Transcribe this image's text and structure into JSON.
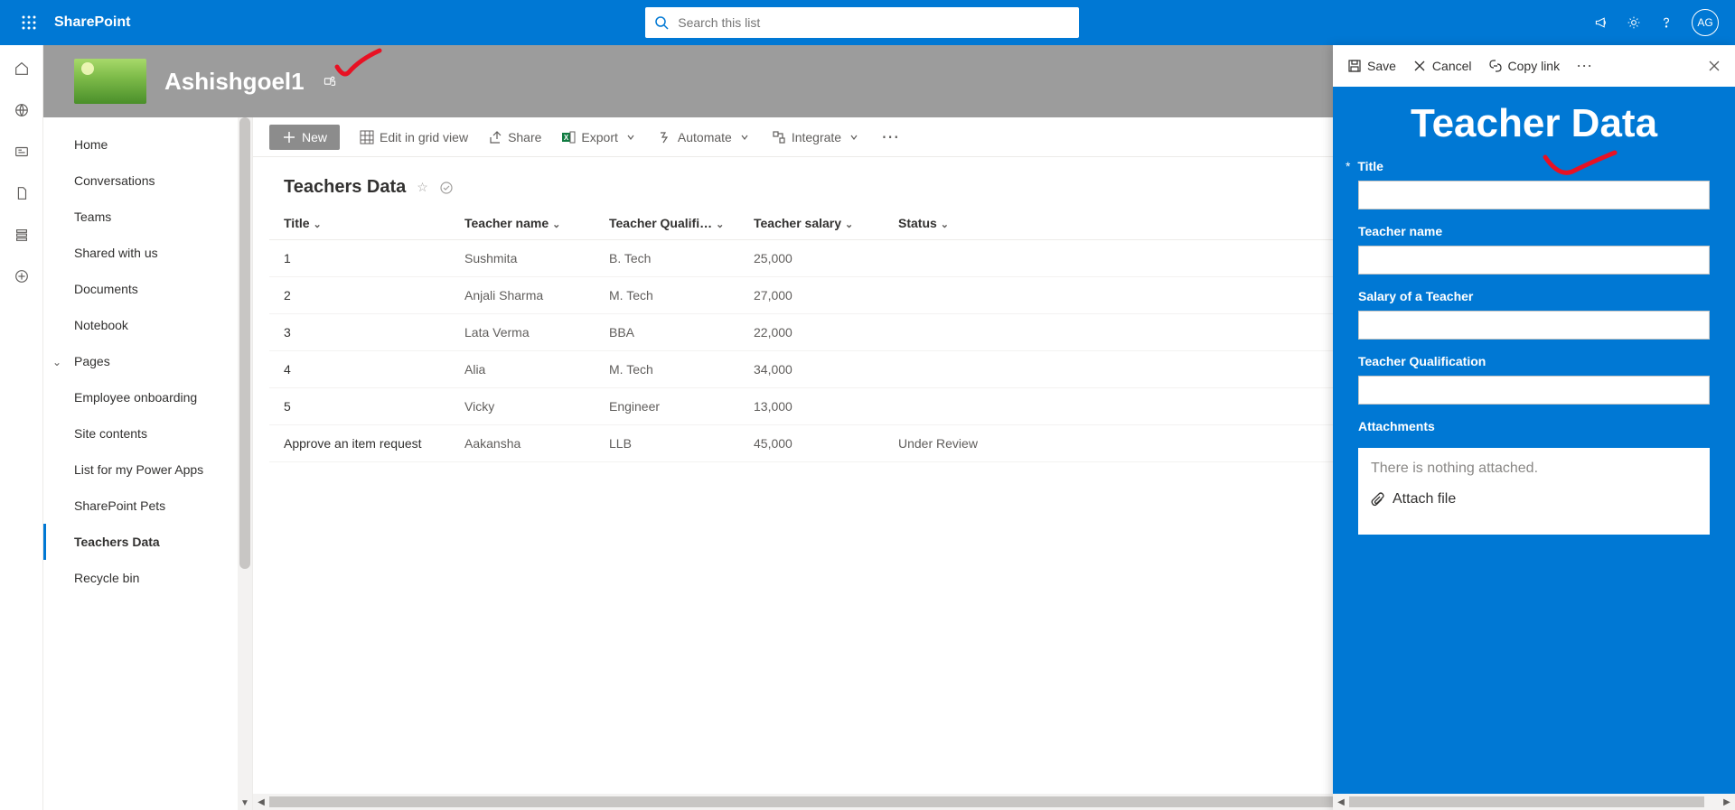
{
  "topbar": {
    "brand": "SharePoint",
    "search_placeholder": "Search this list",
    "avatar_initials": "AG"
  },
  "site": {
    "title": "Ashishgoel1"
  },
  "commands": {
    "new": "New",
    "edit_grid": "Edit in grid view",
    "share": "Share",
    "export": "Export",
    "automate": "Automate",
    "integrate": "Integrate"
  },
  "nav": {
    "items": [
      "Home",
      "Conversations",
      "Teams",
      "Shared with us",
      "Documents",
      "Notebook",
      "Pages",
      "Employee onboarding",
      "Site contents",
      "List for my Power Apps",
      "SharePoint Pets",
      "Teachers Data",
      "Recycle bin"
    ],
    "expandable_index": 6,
    "selected_index": 11
  },
  "list": {
    "title": "Teachers Data",
    "columns": {
      "title": "Title",
      "teacher_name": "Teacher name",
      "teacher_qual": "Teacher Qualifi…",
      "teacher_salary": "Teacher salary",
      "status": "Status"
    },
    "rows": [
      {
        "title": "1",
        "name": "Sushmita",
        "qual": "B. Tech",
        "salary": "25,000",
        "status": ""
      },
      {
        "title": "2",
        "name": "Anjali Sharma",
        "qual": "M. Tech",
        "salary": "27,000",
        "status": ""
      },
      {
        "title": "3",
        "name": "Lata Verma",
        "qual": "BBA",
        "salary": "22,000",
        "status": ""
      },
      {
        "title": "4",
        "name": "Alia",
        "qual": "M. Tech",
        "salary": "34,000",
        "status": ""
      },
      {
        "title": "5",
        "name": "Vicky",
        "qual": "Engineer",
        "salary": "13,000",
        "status": ""
      },
      {
        "title": "Approve an item request",
        "name": "Aakansha",
        "qual": "LLB",
        "salary": "45,000",
        "status": "Under Review"
      }
    ]
  },
  "panel": {
    "save": "Save",
    "cancel": "Cancel",
    "copylink": "Copy link",
    "heading": "Teacher Data",
    "fields": {
      "title": "Title",
      "teacher_name": "Teacher name",
      "salary": "Salary of a Teacher",
      "qualification": "Teacher Qualification",
      "attachments": "Attachments"
    },
    "attach_empty": "There is nothing attached.",
    "attach_btn": "Attach file"
  }
}
